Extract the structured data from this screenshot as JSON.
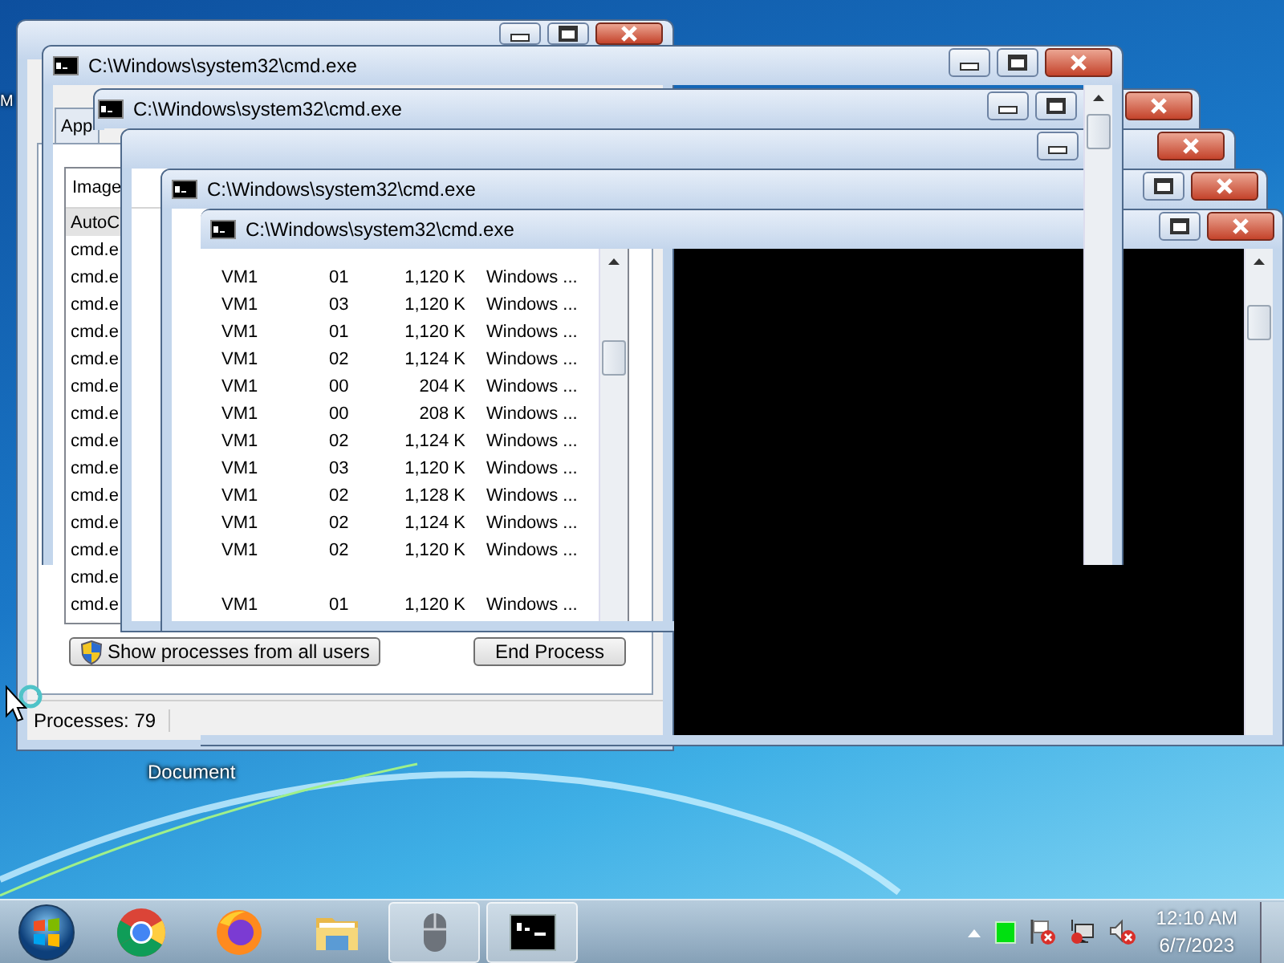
{
  "desktop": {
    "icon_labels": [
      {
        "text": "M"
      },
      {
        "text": "Document"
      }
    ]
  },
  "task_manager": {
    "tabs": [
      {
        "label": "App",
        "selected": false
      }
    ],
    "columns": [
      "Image"
    ],
    "processes": [
      {
        "name": "AutoC",
        "selected": true
      },
      {
        "name": "cmd.e",
        "selected": false
      },
      {
        "name": "cmd.e",
        "selected": false,
        "user": "VM1",
        "cpu": "01",
        "memory": "1,120 K",
        "description": "Windows ..."
      },
      {
        "name": "cmd.e",
        "selected": false,
        "user": "VM1",
        "cpu": "03",
        "memory": "1,120 K",
        "description": "Windows ..."
      },
      {
        "name": "cmd.e",
        "selected": false,
        "user": "VM1",
        "cpu": "01",
        "memory": "1,120 K",
        "description": "Windows ..."
      },
      {
        "name": "cmd.e",
        "selected": false,
        "user": "VM1",
        "cpu": "02",
        "memory": "1,124 K",
        "description": "Windows ..."
      },
      {
        "name": "cmd.e",
        "selected": false,
        "user": "VM1",
        "cpu": "00",
        "memory": "204 K",
        "description": "Windows ..."
      },
      {
        "name": "cmd.e",
        "selected": false,
        "user": "VM1",
        "cpu": "00",
        "memory": "208 K",
        "description": "Windows ..."
      },
      {
        "name": "cmd.e",
        "selected": false,
        "user": "VM1",
        "cpu": "02",
        "memory": "1,124 K",
        "description": "Windows ..."
      },
      {
        "name": "cmd.e",
        "selected": false,
        "user": "VM1",
        "cpu": "03",
        "memory": "1,120 K",
        "description": "Windows ..."
      },
      {
        "name": "cmd.e",
        "selected": false,
        "user": "VM1",
        "cpu": "02",
        "memory": "1,128 K",
        "description": "Windows ..."
      },
      {
        "name": "cmd.e",
        "selected": false,
        "user": "VM1",
        "cpu": "02",
        "memory": "1,124 K",
        "description": "Windows ..."
      },
      {
        "name": "cmd.e",
        "selected": false,
        "user": "VM1",
        "cpu": "02",
        "memory": "1,120 K",
        "description": "Windows ..."
      },
      {
        "name": "cmd.e",
        "selected": false
      },
      {
        "name": "cmd.e",
        "selected": false,
        "user": "VM1",
        "cpu": "01",
        "memory": "1,120 K",
        "description": "Windows ..."
      }
    ],
    "buttons": [
      {
        "kind": "shield",
        "label": "Show processes from all users"
      },
      {
        "kind": "plain",
        "label": "End Process"
      }
    ],
    "status": "Processes: 79"
  },
  "cmd_windows": [
    {
      "title": "C:\\Windows\\system32\\cmd.exe",
      "minimize_button": true,
      "maximize_button": true,
      "close_button": true
    },
    {
      "title": "C:\\Windows\\system32\\cmd.exe",
      "minimize_button": true,
      "maximize_button": true,
      "close_button": true
    },
    {
      "minimize_button": true,
      "maximize_button": false,
      "close_button": true
    },
    {
      "title": "C:\\Windows\\system32\\cmd.exe",
      "minimize_button": false,
      "maximize_button": true,
      "close_button": true
    },
    {
      "title": "C:\\Windows\\system32\\cmd.exe",
      "minimize_button": false,
      "maximize_button": true,
      "close_button": true
    }
  ],
  "taskbar": {
    "items": [
      {
        "kind": "round-browser",
        "active": false
      },
      {
        "kind": "fox-browser",
        "active": false
      },
      {
        "kind": "folder",
        "active": false
      },
      {
        "kind": "mouse",
        "active": true
      },
      {
        "kind": "console",
        "active": true
      }
    ],
    "clock": {
      "time": "12:10 AM",
      "date": "6/7/2023"
    }
  }
}
